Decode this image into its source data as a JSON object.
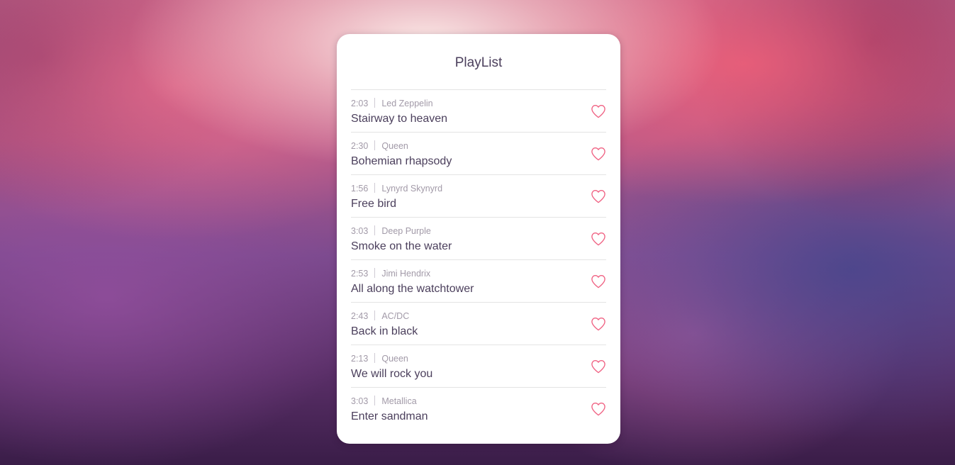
{
  "playlist": {
    "title": "PlayList",
    "accent_color": "#f06283",
    "items": [
      {
        "duration": "2:03",
        "artist": "Led Zeppelin",
        "title": "Stairway to heaven",
        "icon": "heart-outline-icon"
      },
      {
        "duration": "2:30",
        "artist": "Queen",
        "title": "Bohemian rhapsody",
        "icon": "heart-outline-icon"
      },
      {
        "duration": "1:56",
        "artist": "Lynyrd Skynyrd",
        "title": "Free bird",
        "icon": "heart-outline-icon"
      },
      {
        "duration": "3:03",
        "artist": "Deep Purple",
        "title": "Smoke on the water",
        "icon": "heart-outline-icon"
      },
      {
        "duration": "2:53",
        "artist": "Jimi Hendrix",
        "title": "All along the watchtower",
        "icon": "heart-outline-icon"
      },
      {
        "duration": "2:43",
        "artist": "AC/DC",
        "title": "Back in black",
        "icon": "heart-outline-icon"
      },
      {
        "duration": "2:13",
        "artist": "Queen",
        "title": "We will rock you",
        "icon": "heart-outline-icon"
      },
      {
        "duration": "3:03",
        "artist": "Metallica",
        "title": "Enter sandman",
        "icon": "heart-outline-icon"
      }
    ]
  }
}
